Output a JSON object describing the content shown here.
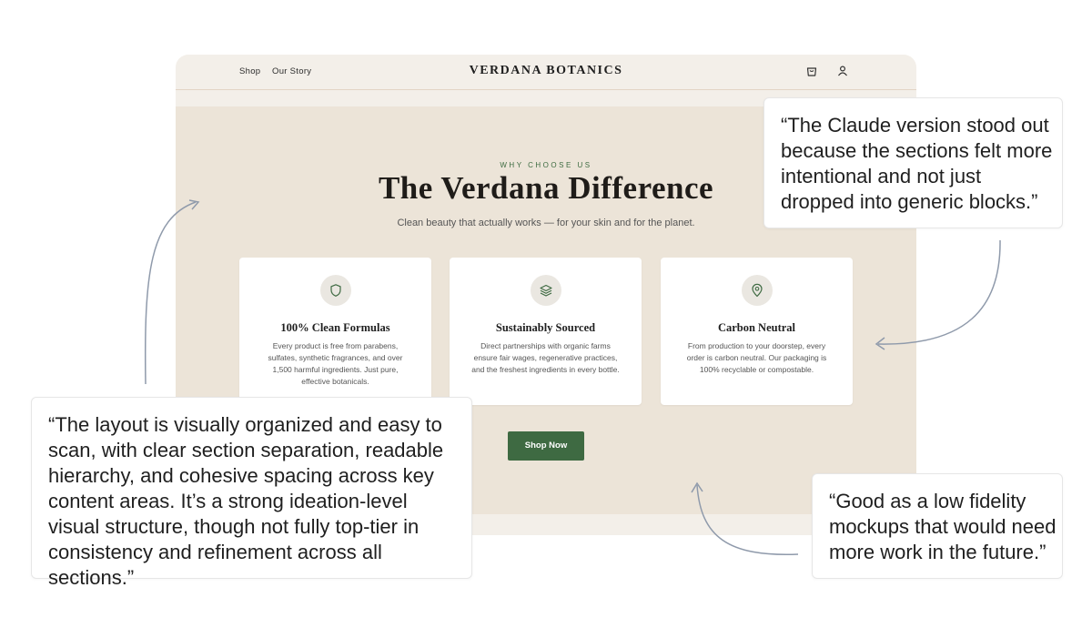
{
  "nav": {
    "links": [
      "Shop",
      "Our Story"
    ],
    "brand": "VERDANA BOTANICS",
    "icons": [
      "cart-icon",
      "user-icon"
    ]
  },
  "hero": {
    "eyebrow": "WHY CHOOSE US",
    "title": "The Verdana Difference",
    "subtitle": "Clean beauty that actually works — for your skin and for the planet.",
    "cards": [
      {
        "icon": "shield-icon",
        "title": "100% Clean Formulas",
        "text": "Every product is free from parabens, sulfates, synthetic fragrances, and over 1,500 harmful ingredients. Just pure, effective botanicals."
      },
      {
        "icon": "layers-icon",
        "title": "Sustainably Sourced",
        "text": "Direct partnerships with organic farms ensure fair wages, regenerative practices, and the freshest ingredients in every bottle."
      },
      {
        "icon": "map-pin-icon",
        "title": "Carbon Neutral",
        "text": "From production to your doorstep, every order is carbon neutral. Our packaging is 100% recyclable or compostable."
      }
    ],
    "cta_label": "Shop Now"
  },
  "testimonials": {
    "top_right": "“The Claude version stood out because the sections felt more intentional and not just dropped into generic blocks.”",
    "bottom_left": "“The layout is visually organized and easy to scan, with clear section separation, readable hierarchy, and cohesive spacing across key content areas. It’s a strong ideation-level visual structure, though not fully top-tier in consistency and refinement across all sections.”",
    "bottom_right": "“Good as a low fidelity mockups that would need more work in the future.”"
  },
  "colors": {
    "accent_green": "#3e6a42",
    "hero_bg": "#ece4d8",
    "nav_bg": "#f3efe9"
  }
}
